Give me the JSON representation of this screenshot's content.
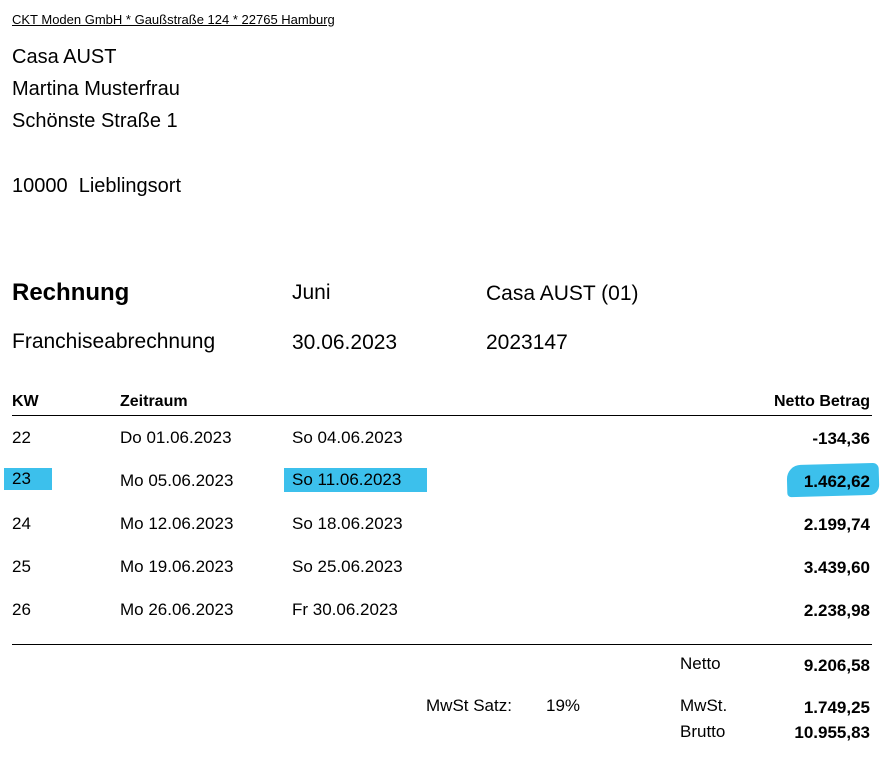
{
  "sender_line": "CKT Moden GmbH * Gaußstraße 124 * 22765 Hamburg",
  "recipient": {
    "company": "Casa AUST",
    "name": "Martina Musterfrau",
    "street": "Schönste Straße 1",
    "city": "10000  Lieblingsort"
  },
  "invoice": {
    "title": "Rechnung",
    "subtitle": "Franchiseabrechnung",
    "month": "Juni",
    "date": "30.06.2023",
    "customer": "Casa AUST (01)",
    "number": "2023147"
  },
  "table": {
    "headers": {
      "kw": "KW",
      "period": "Zeitraum",
      "amount": "Netto Betrag"
    },
    "rows": [
      {
        "kw": "22",
        "from": "Do 01.06.2023",
        "to": "So 04.06.2023",
        "amount": "-134,36",
        "highlighted": false
      },
      {
        "kw": "23",
        "from": "Mo 05.06.2023",
        "to": "So 11.06.2023",
        "amount": "1.462,62",
        "highlighted": true
      },
      {
        "kw": "24",
        "from": "Mo 12.06.2023",
        "to": "So 18.06.2023",
        "amount": "2.199,74",
        "highlighted": false
      },
      {
        "kw": "25",
        "from": "Mo 19.06.2023",
        "to": "So 25.06.2023",
        "amount": "3.439,60",
        "highlighted": false
      },
      {
        "kw": "26",
        "from": "Mo 26.06.2023",
        "to": "Fr 30.06.2023",
        "amount": "2.238,98",
        "highlighted": false
      }
    ]
  },
  "totals": {
    "netto_label": "Netto",
    "netto_value": "9.206,58",
    "vat_rate_label": "MwSt Satz:",
    "vat_rate_value": "19%",
    "vat_label": "MwSt.",
    "vat_value": "1.749,25",
    "brutto_label": "Brutto",
    "brutto_value": "10.955,83"
  },
  "colors": {
    "highlight": "#3cc0ec"
  }
}
